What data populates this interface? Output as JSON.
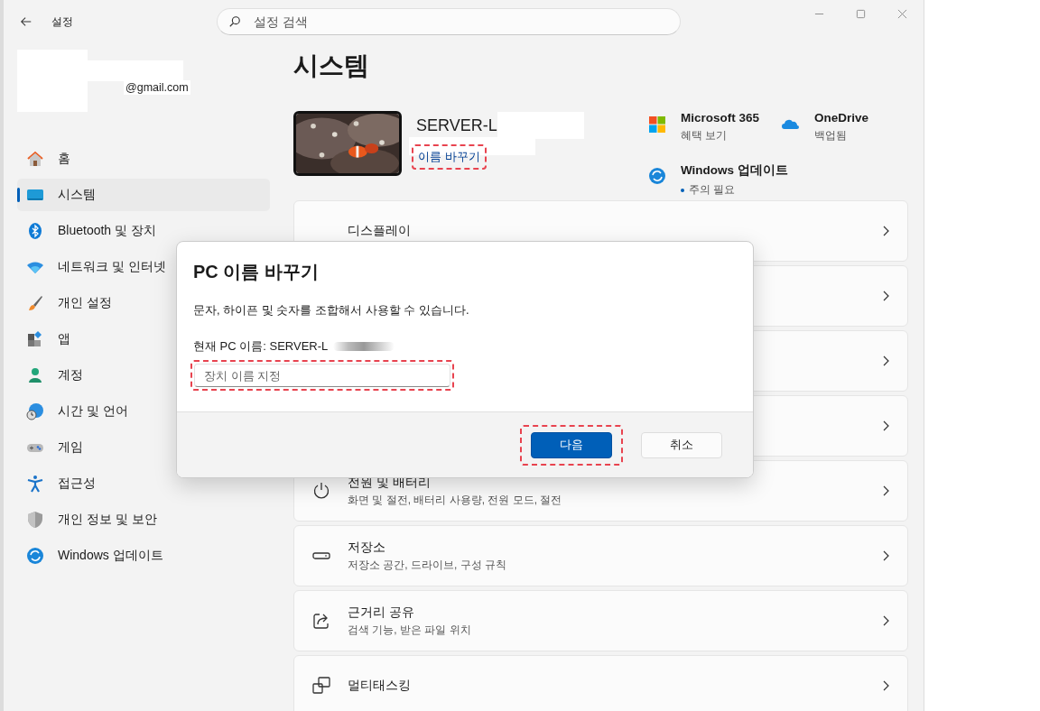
{
  "window": {
    "title": "설정",
    "search": {
      "placeholder": "설정 검색"
    }
  },
  "account": {
    "email": "@gmail.com"
  },
  "sidebar": {
    "items": [
      {
        "kind": "home",
        "label": "홈",
        "selected": false
      },
      {
        "kind": "system",
        "label": "시스템",
        "selected": true
      },
      {
        "kind": "bluetooth",
        "label": "Bluetooth 및 장치",
        "selected": false
      },
      {
        "kind": "network",
        "label": "네트워크 및 인터넷",
        "selected": false
      },
      {
        "kind": "personalization",
        "label": "개인 설정",
        "selected": false
      },
      {
        "kind": "apps",
        "label": "앱",
        "selected": false
      },
      {
        "kind": "accounts",
        "label": "계정",
        "selected": false
      },
      {
        "kind": "time",
        "label": "시간 및 언어",
        "selected": false
      },
      {
        "kind": "gaming",
        "label": "게임",
        "selected": false
      },
      {
        "kind": "accessibility",
        "label": "접근성",
        "selected": false
      },
      {
        "kind": "privacy",
        "label": "개인 정보 및 보안",
        "selected": false
      },
      {
        "kind": "update",
        "label": "Windows 업데이트",
        "selected": false
      }
    ]
  },
  "page": {
    "title": "시스템",
    "device": {
      "name": "SERVER-L",
      "rename_link": {
        "label": "이름 바꾸기",
        "highlighted": true
      }
    },
    "services": [
      {
        "kind": "m365",
        "title": "Microsoft 365",
        "subtitle": "혜택 보기",
        "alert": false
      },
      {
        "kind": "onedrive",
        "title": "OneDrive",
        "subtitle": "백업됨",
        "alert": false
      },
      {
        "kind": "update",
        "title": "Windows 업데이트",
        "subtitle": "주의 필요",
        "alert": true
      }
    ]
  },
  "cards": [
    {
      "kind": "display",
      "title": "디스플레이"
    },
    {
      "kind": "covered"
    },
    {
      "kind": "covered"
    },
    {
      "kind": "covered"
    },
    {
      "kind": "power",
      "title": "전원 및 배터리",
      "subtitle": "화면 및 절전, 배터리 사용량, 전원 모드, 절전"
    },
    {
      "kind": "storage",
      "title": "저장소",
      "subtitle": "저장소 공간, 드라이브, 구성 규칙"
    },
    {
      "kind": "share",
      "title": "근거리 공유",
      "subtitle": "검색 기능, 받은 파일 위치"
    },
    {
      "kind": "multitask",
      "title": "멀티태스킹"
    }
  ],
  "dialog": {
    "title": "PC 이름 바꾸기",
    "description": "문자, 하이픈 및 숫자를 조합해서 사용할 수 있습니다.",
    "current_name": "현재 PC 이름: SERVER-L",
    "input": {
      "placeholder": "장치 이름 지정",
      "highlighted": true
    },
    "buttons": [
      {
        "kind": "primary",
        "label": "다음",
        "highlighted": true
      },
      {
        "kind": "secondary",
        "label": "취소",
        "highlighted": false
      }
    ]
  }
}
